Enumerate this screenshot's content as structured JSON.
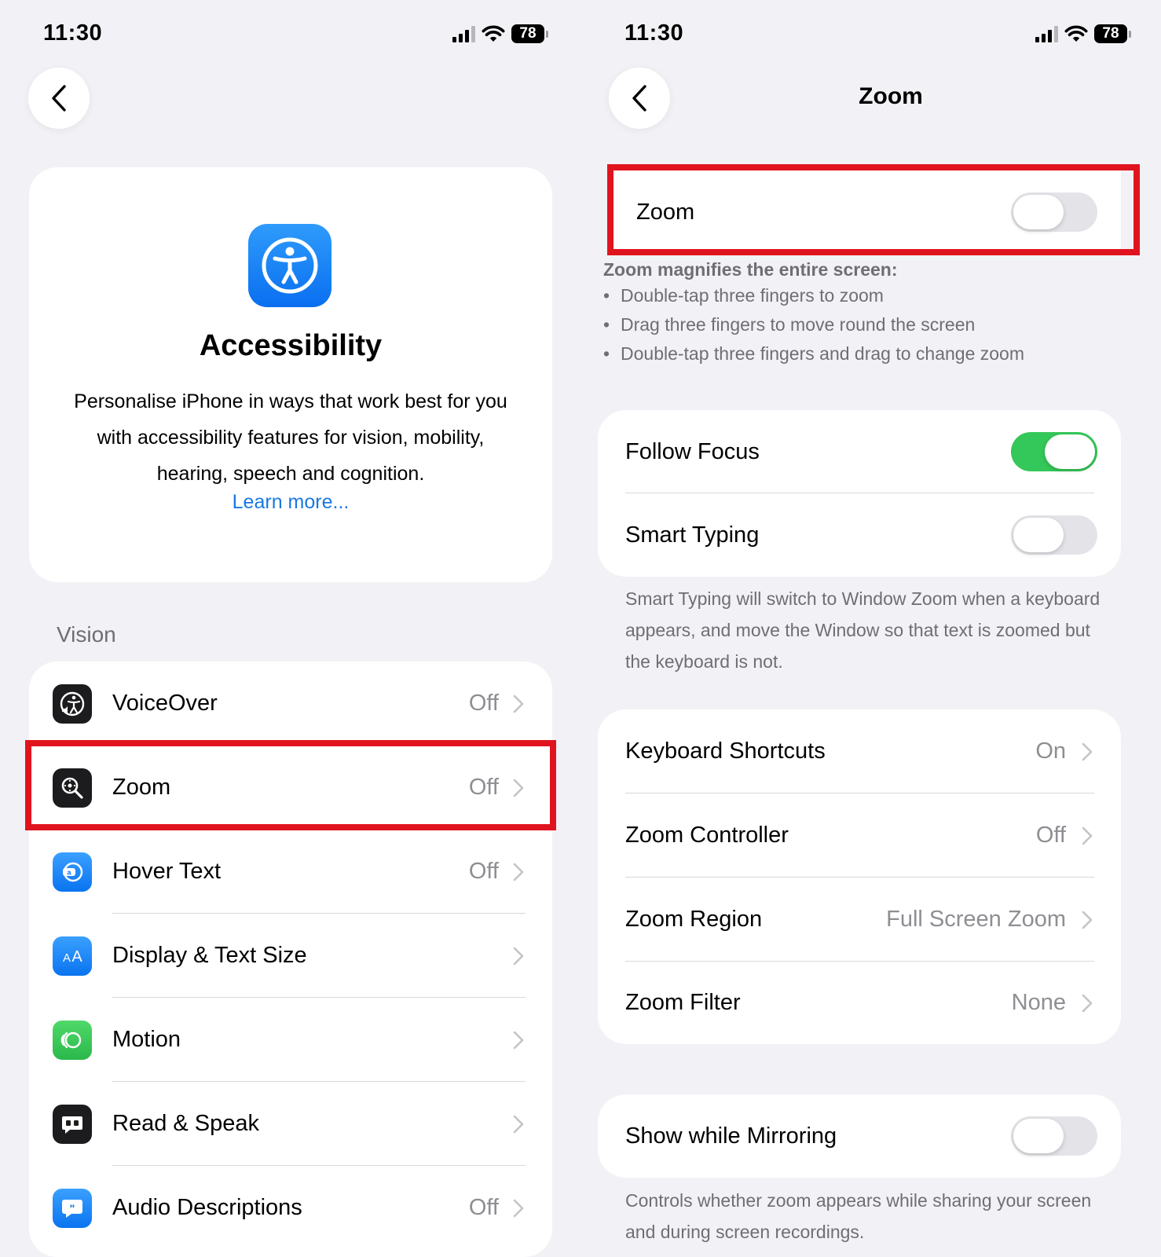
{
  "left": {
    "status": {
      "time": "11:30",
      "battery": "78"
    },
    "hero": {
      "title": "Accessibility",
      "description": "Personalise iPhone in ways that work best for you with accessibility features for vision, mobility, hearing, speech and cognition.",
      "link": "Learn more..."
    },
    "section": "Vision",
    "items": [
      {
        "label": "VoiceOver",
        "value": "Off",
        "icon": "voiceover-icon"
      },
      {
        "label": "Zoom",
        "value": "Off",
        "icon": "zoom-icon"
      },
      {
        "label": "Hover Text",
        "value": "Off",
        "icon": "hover-text-icon"
      },
      {
        "label": "Display & Text Size",
        "value": "",
        "icon": "text-size-icon"
      },
      {
        "label": "Motion",
        "value": "",
        "icon": "motion-icon"
      },
      {
        "label": "Read & Speak",
        "value": "",
        "icon": "read-speak-icon"
      },
      {
        "label": "Audio Descriptions",
        "value": "Off",
        "icon": "audio-descriptions-icon"
      }
    ]
  },
  "right": {
    "status": {
      "time": "11:30",
      "battery": "78"
    },
    "title": "Zoom",
    "zoom_toggle": {
      "label": "Zoom",
      "on": false
    },
    "description": {
      "heading": "Zoom magnifies the entire screen:",
      "bullets": [
        "Double-tap three fingers to zoom",
        "Drag three fingers to move round the screen",
        "Double-tap three fingers and drag to change zoom"
      ]
    },
    "focus_group": [
      {
        "label": "Follow Focus",
        "on": true
      },
      {
        "label": "Smart Typing",
        "on": false
      }
    ],
    "smart_typing_footer": "Smart Typing will switch to Window Zoom when a keyboard appears, and move the Window so that text is zoomed but the keyboard is not.",
    "settings": [
      {
        "label": "Keyboard Shortcuts",
        "value": "On"
      },
      {
        "label": "Zoom Controller",
        "value": "Off"
      },
      {
        "label": "Zoom Region",
        "value": "Full Screen Zoom"
      },
      {
        "label": "Zoom Filter",
        "value": "None"
      }
    ],
    "mirroring": {
      "label": "Show while Mirroring",
      "on": false
    },
    "mirroring_footer": "Controls whether zoom appears while sharing your screen and during screen recordings."
  },
  "colors": {
    "highlight": "#e0141e",
    "toggle_on": "#34c759",
    "link": "#1a78e2",
    "accent_blue": "#0a6ff0"
  }
}
